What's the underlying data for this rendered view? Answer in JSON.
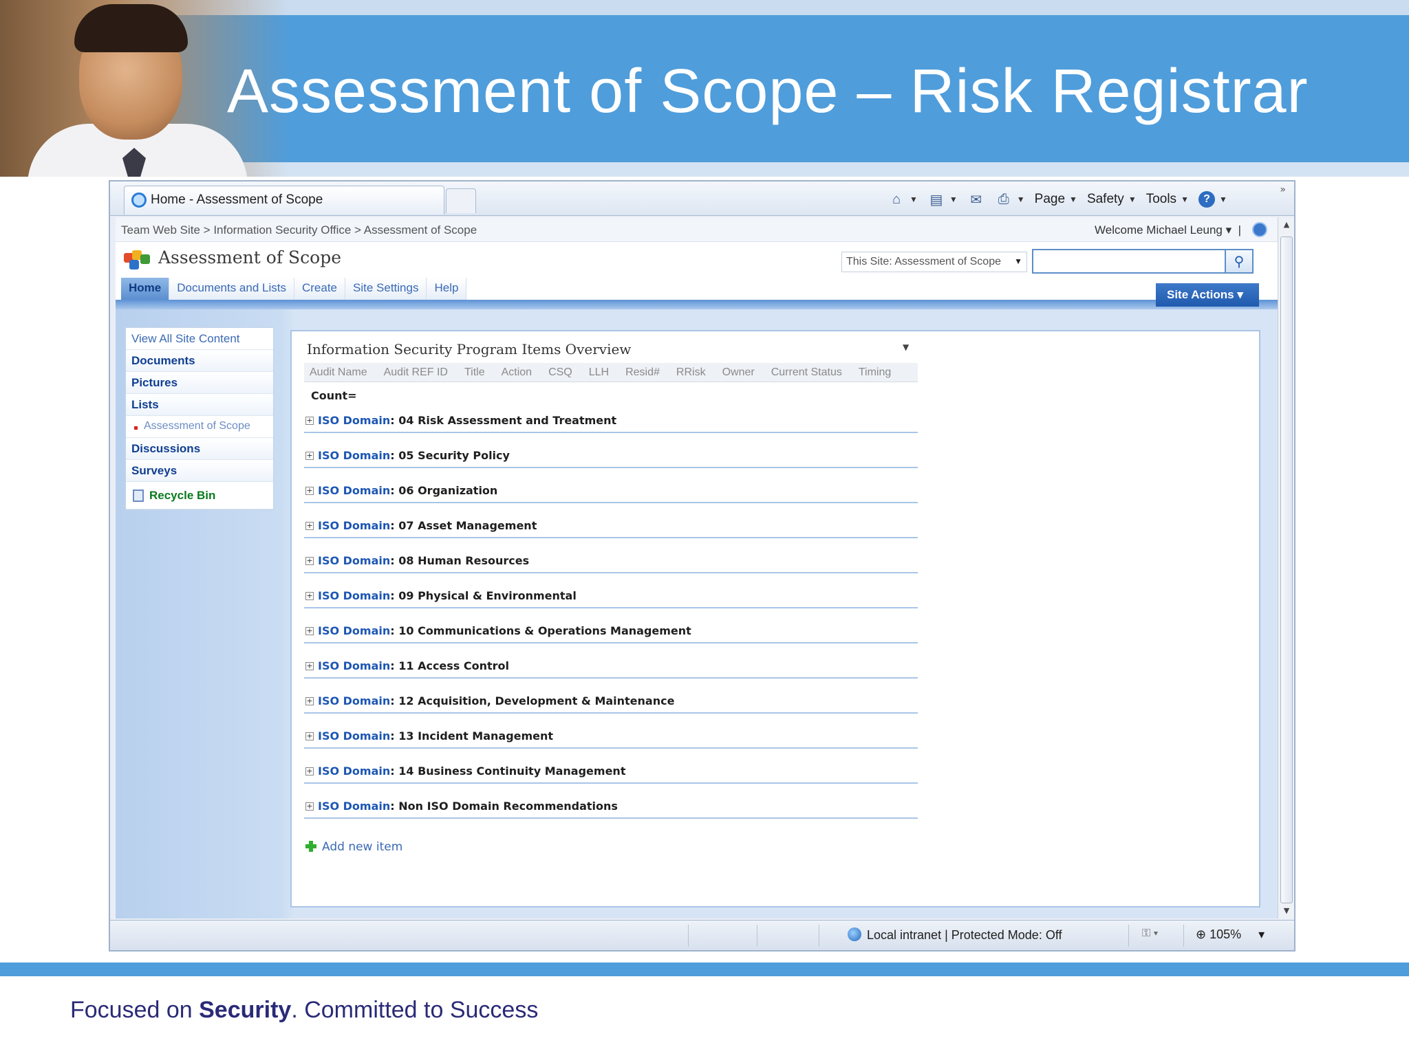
{
  "slide": {
    "title": "Assessment of Scope – Risk Registrar",
    "tagline_pre": "Focused on ",
    "tagline_bold": "Security",
    "tagline_post": ". Committed to Success",
    "accent_color": "#4f9ddb"
  },
  "browser": {
    "tab_title": "Home - Assessment of Scope",
    "command_bar": {
      "page": "Page",
      "safety": "Safety",
      "tools": "Tools"
    },
    "status": {
      "zone": "Local intranet | Protected Mode: Off",
      "zoom": "105%"
    }
  },
  "sharepoint": {
    "breadcrumb": "Team Web Site > Information Security Office > Assessment of Scope",
    "welcome": "Welcome Michael Leung",
    "site_title": "Assessment of Scope",
    "search_scope": "This Site: Assessment of Scope",
    "search_value": "",
    "site_actions": "Site Actions",
    "topnav": [
      "Home",
      "Documents and Lists",
      "Create",
      "Site Settings",
      "Help"
    ],
    "quicklaunch": {
      "view_all": "View All Site Content",
      "documents": "Documents",
      "pictures": "Pictures",
      "lists": "Lists",
      "list_child": "Assessment of Scope",
      "discussions": "Discussions",
      "surveys": "Surveys",
      "recycle_bin": "Recycle Bin"
    },
    "webpart": {
      "title": "Information Security Program Items Overview",
      "columns": [
        "Audit Name",
        "Audit REF ID",
        "Title",
        "Action",
        "CSQ",
        "LLH",
        "Resid#",
        "RRisk",
        "Owner",
        "Current Status",
        "Timing"
      ],
      "count_label": "Count=",
      "group_key": "ISO Domain",
      "groups": [
        ": 04 Risk Assessment and Treatment",
        ": 05 Security Policy",
        ": 06 Organization",
        ": 07 Asset Management",
        ": 08 Human Resources",
        ": 09 Physical & Environmental",
        ": 10 Communications & Operations Management",
        ": 11 Access Control",
        ": 12 Acquisition, Development & Maintenance",
        ": 13 Incident Management",
        ": 14 Business Continuity Management",
        ": Non ISO Domain Recommendations"
      ],
      "add_new": "Add new item"
    }
  }
}
